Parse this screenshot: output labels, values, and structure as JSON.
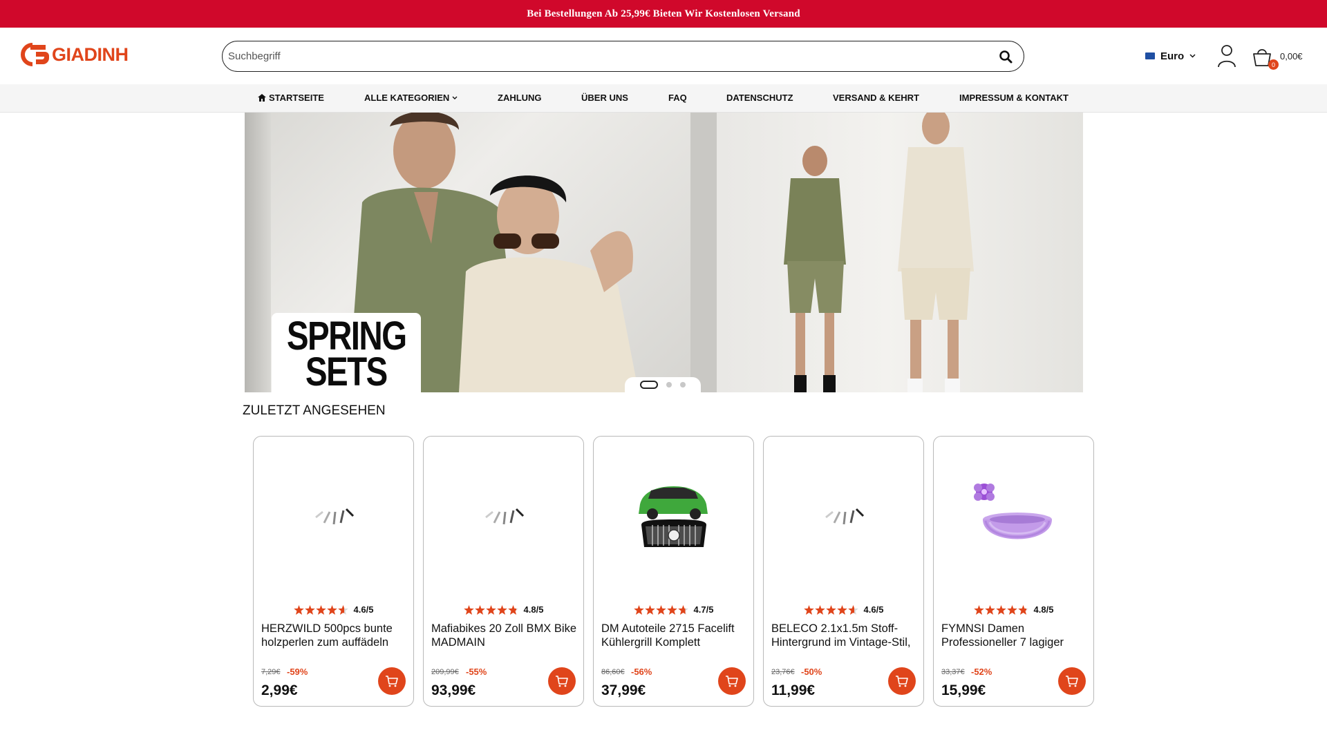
{
  "announcement": "Bei Bestellungen Ab 25,99€ Bieten Wir Kostenlosen Versand",
  "brand": {
    "name": "GIADINH",
    "color": "#e0451b",
    "topbar_color": "#d0082b"
  },
  "search": {
    "placeholder": "Suchbegriff"
  },
  "currency": {
    "label": "Euro",
    "flag": "eu-flag-icon"
  },
  "cart": {
    "count": "0",
    "total": "0,00€"
  },
  "nav": {
    "home": "STARTSEITE",
    "categories": "ALLE KATEGORIEN",
    "payment": "ZAHLUNG",
    "about": "ÜBER UNS",
    "faq": "FAQ",
    "privacy": "DATENSCHUTZ",
    "shipping": "VERSAND & KEHRT",
    "imprint": "IMPRESSUM & KONTAKT"
  },
  "banner": {
    "line1": "SPRING",
    "line2": "SETS",
    "slides": 3,
    "active_slide": 1
  },
  "recent": {
    "title": "ZULETZT ANGESEHEN",
    "products": [
      {
        "title": "HERZWILD 500pcs bunte holzperlen zum auffädeln",
        "rating": "4.6/5",
        "old_price": "7,29€",
        "discount": "-59%",
        "price": "2,99€",
        "image": "loading-spinner"
      },
      {
        "title": "Mafiabikes 20 Zoll BMX Bike MADMAIN",
        "rating": "4.8/5",
        "old_price": "209,99€",
        "discount": "-55%",
        "price": "93,99€",
        "image": "loading-spinner"
      },
      {
        "title": "DM Autoteile 2715 Facelift Kühlergrill Komplett",
        "rating": "4.7/5",
        "old_price": "86,60€",
        "discount": "-56%",
        "price": "37,99€",
        "image": "green-car-grill"
      },
      {
        "title": "BELECO 2.1x1.5m Stoff-Hintergrund im Vintage-Stil,",
        "rating": "4.6/5",
        "old_price": "23,76€",
        "discount": "-50%",
        "price": "11,99€",
        "image": "loading-spinner"
      },
      {
        "title": "FYMNSI Damen Professioneller 7 lagiger",
        "rating": "4.8/5",
        "old_price": "33,37€",
        "discount": "-52%",
        "price": "15,99€",
        "image": "purple-tutu"
      }
    ]
  }
}
